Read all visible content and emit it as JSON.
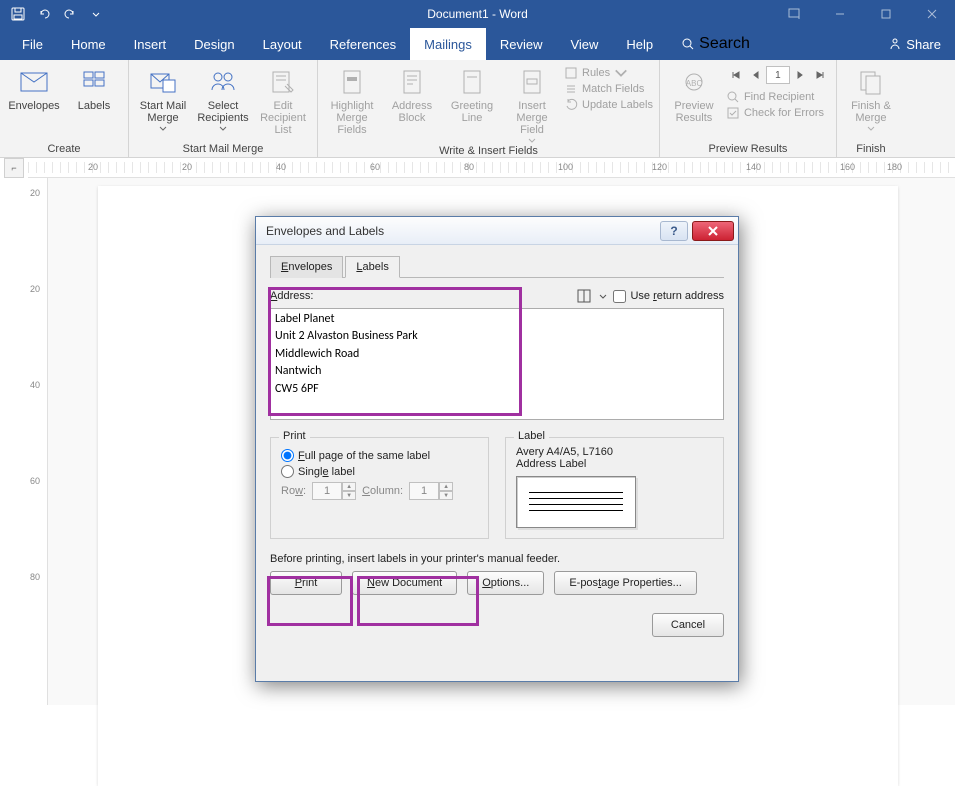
{
  "app": {
    "title": "Document1 - Word"
  },
  "tabs": {
    "file": "File",
    "home": "Home",
    "insert": "Insert",
    "design": "Design",
    "layout": "Layout",
    "references": "References",
    "mailings": "Mailings",
    "review": "Review",
    "view": "View",
    "help": "Help",
    "search": "Search",
    "share": "Share"
  },
  "ribbon": {
    "create": {
      "label": "Create",
      "envelopes": "Envelopes",
      "labels": "Labels"
    },
    "smm": {
      "label": "Start Mail Merge",
      "start": "Start Mail\nMerge",
      "select": "Select\nRecipients",
      "edit": "Edit\nRecipient List"
    },
    "wif": {
      "label": "Write & Insert Fields",
      "highlight": "Highlight\nMerge Fields",
      "addrblock": "Address\nBlock",
      "greeting": "Greeting\nLine",
      "insertmf": "Insert Merge\nField",
      "rules": "Rules",
      "match": "Match Fields",
      "update": "Update Labels"
    },
    "preview": {
      "label": "Preview Results",
      "preview": "Preview\nResults",
      "find": "Find Recipient",
      "check": "Check for Errors",
      "recnum": "1"
    },
    "finish": {
      "label": "Finish",
      "finish": "Finish &\nMerge"
    }
  },
  "ruler_h": [
    "20",
    "",
    "20",
    "",
    "40",
    "",
    "60",
    "",
    "80",
    "",
    "100",
    "",
    "120",
    "",
    "140",
    "",
    "160",
    "180"
  ],
  "ruler_v": [
    "20",
    "",
    "20",
    "",
    "40",
    "",
    "60",
    "",
    "80"
  ],
  "dialog": {
    "title": "Envelopes and Labels",
    "tabs": {
      "envelopes": "Envelopes",
      "labels": "Labels"
    },
    "address_label": "Address:",
    "use_return": "Use return address",
    "address_text": "Label Planet\nUnit 2 Alvaston Business Park\nMiddlewich Road\nNantwich\nCW5 6PF",
    "print_group": "Print",
    "full_page": "Full page of the same label",
    "single": "Single label",
    "row_lbl": "Row:",
    "row_val": "1",
    "col_lbl": "Column:",
    "col_val": "1",
    "label_group": "Label",
    "label_info1": "Avery A4/A5, L7160",
    "label_info2": "Address Label",
    "hint": "Before printing, insert labels in your printer's manual feeder.",
    "btn_print": "Print",
    "btn_newdoc": "New Document",
    "btn_options": "Options...",
    "btn_epostage": "E-postage Properties...",
    "btn_cancel": "Cancel"
  }
}
